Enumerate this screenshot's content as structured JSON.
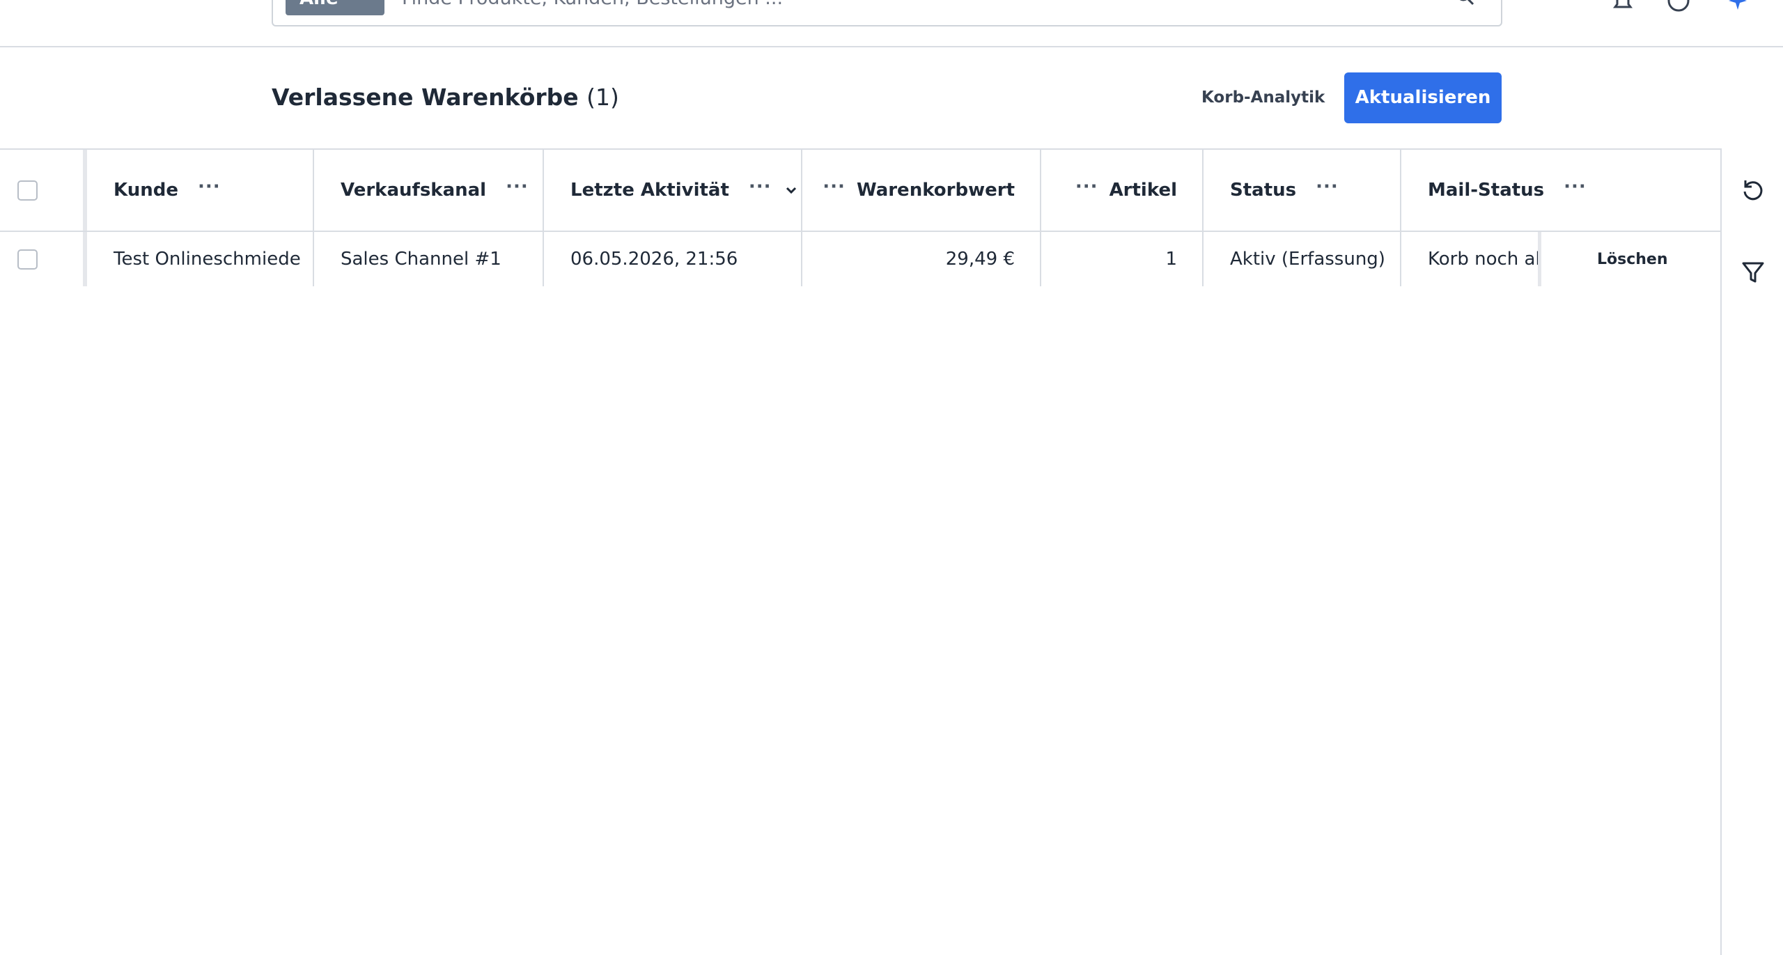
{
  "search": {
    "type_label": "Alle",
    "placeholder": "Finde Produkte, Kunden, Bestellungen ..."
  },
  "header": {
    "title": "Verlassene Warenkörbe",
    "count": "(1)",
    "analytics_label": "Korb-Analytik",
    "refresh_label": "Aktualisieren"
  },
  "grid": {
    "columns": [
      "Kunde",
      "Verkaufskanal",
      "Letzte Aktivität",
      "Warenkorbwert",
      "Artikel",
      "Status",
      "Mail-Status"
    ],
    "menu_glyph": "···",
    "rows": [
      {
        "customer": "Test Onlineschmiede",
        "channel": "Sales Channel #1",
        "last_activity": "06.05.2026, 21:56",
        "value": "29,49 €",
        "items": "1",
        "status": "Aktiv (Erfassung)",
        "mail_status": "Korb noch ak",
        "delete_label": "Löschen"
      }
    ]
  },
  "colors": {
    "primary": "#2f6fe9",
    "border": "#d9dde3",
    "search_type_bg": "#6b7a8c"
  },
  "icons": [
    "search-icon",
    "bell-icon",
    "help-icon",
    "assistant-icon",
    "chevron-down-icon",
    "reset-icon",
    "filter-icon"
  ]
}
